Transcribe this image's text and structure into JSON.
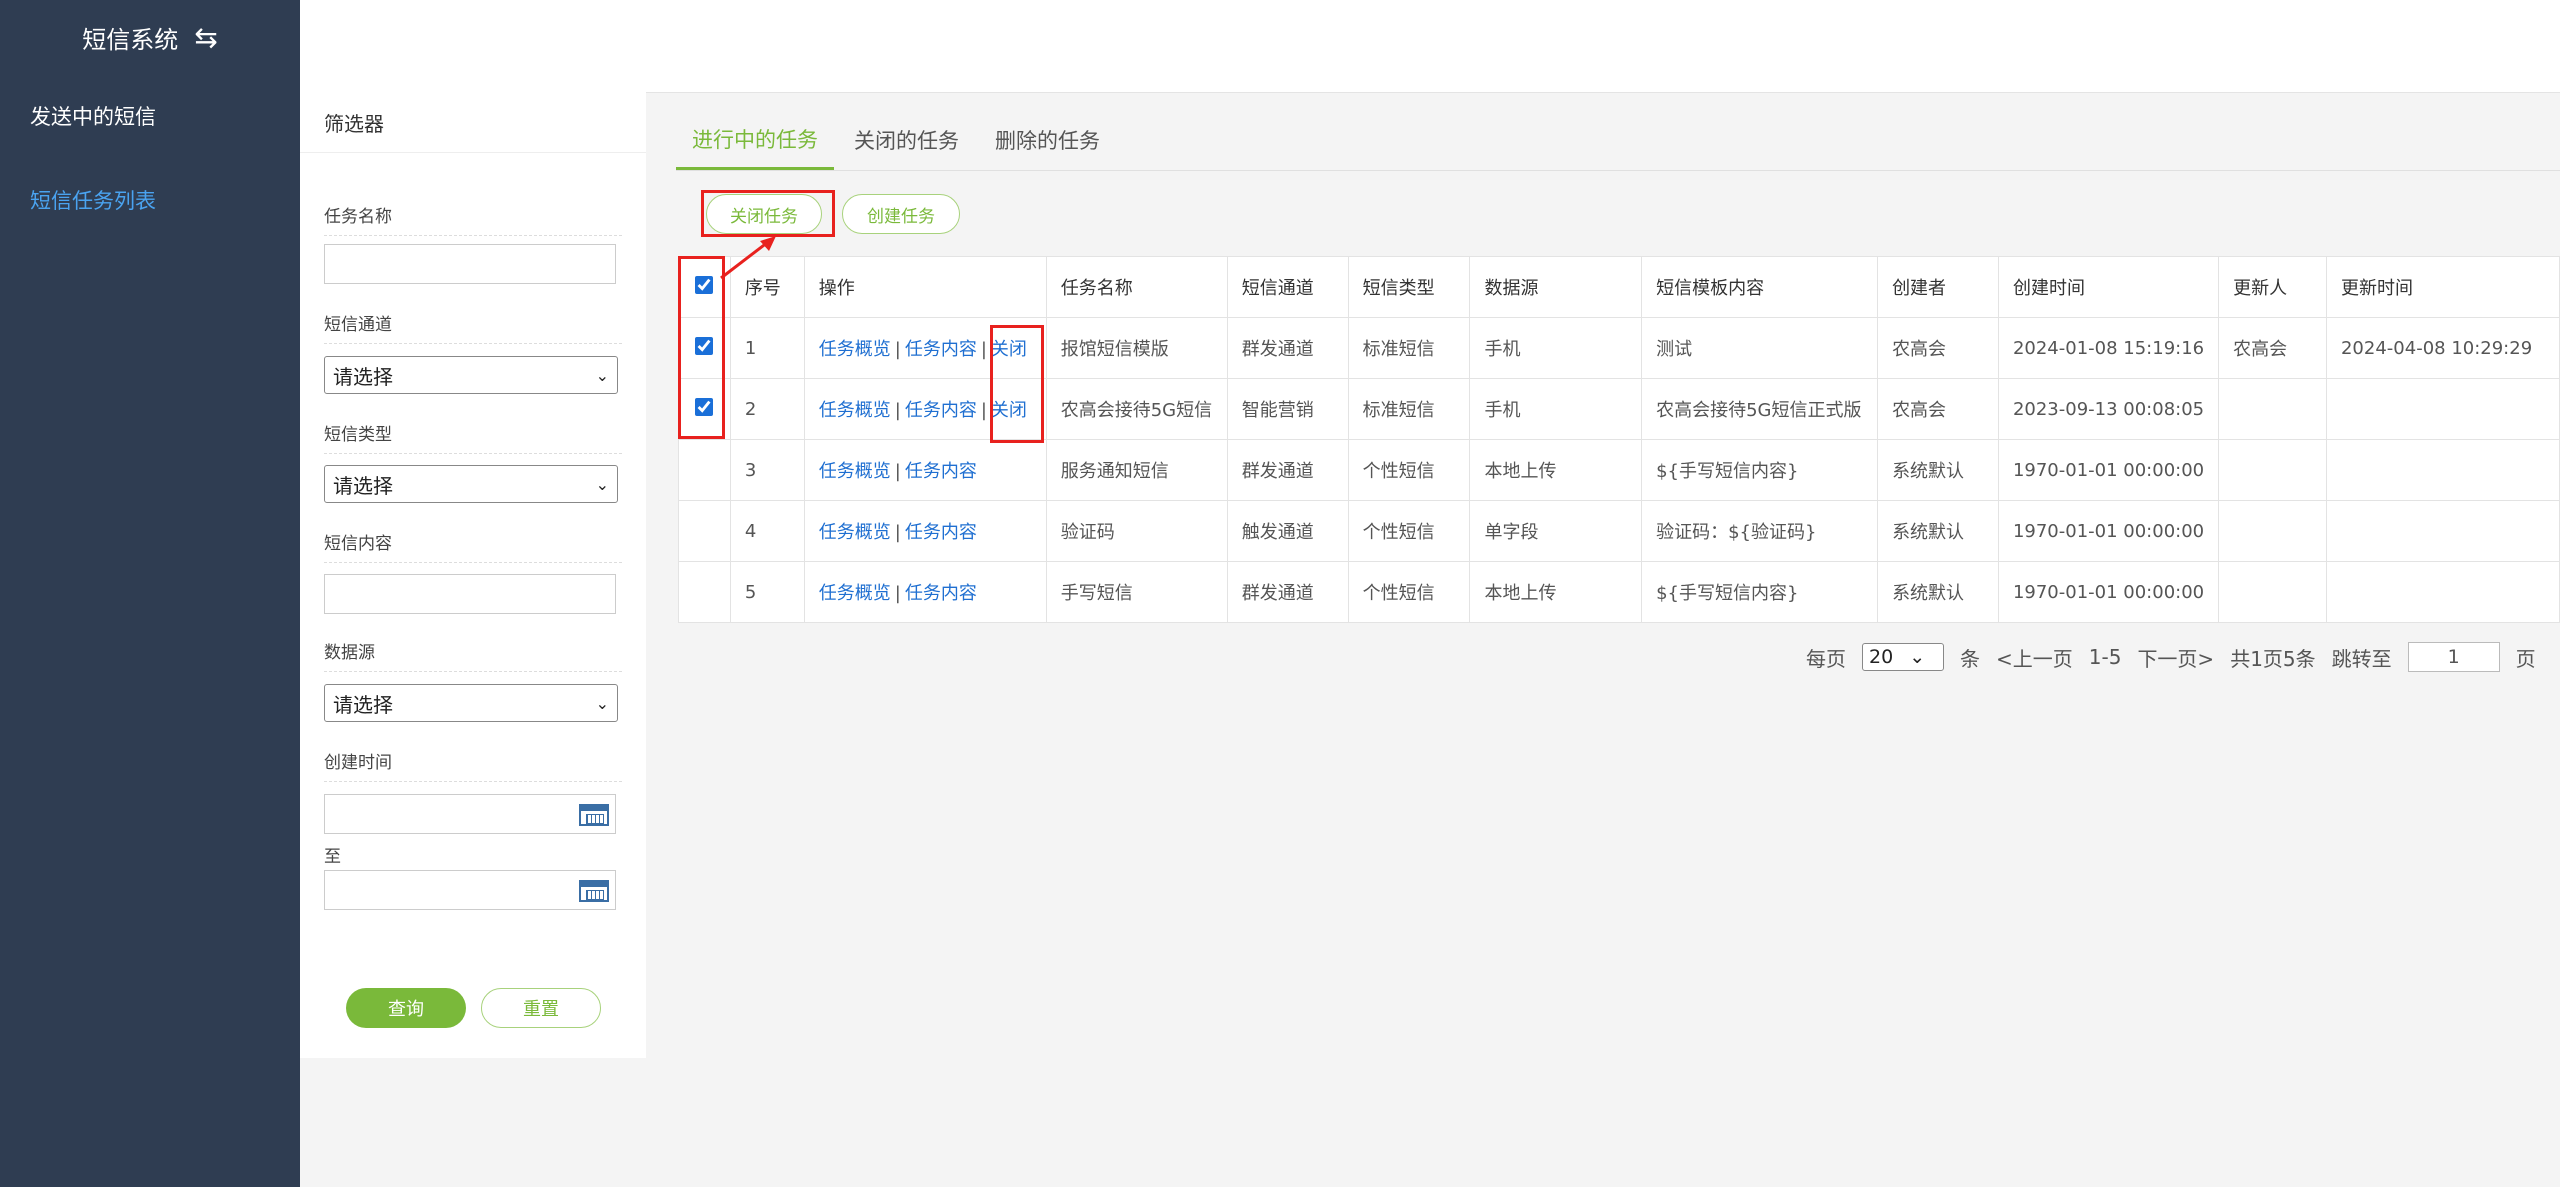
{
  "sidebar": {
    "brand": "短信系统",
    "items": [
      {
        "label": "发送中的短信"
      },
      {
        "label": "短信任务列表"
      }
    ]
  },
  "filter": {
    "title": "筛选器",
    "task_name_label": "任务名称",
    "channel_label": "短信通道",
    "channel_value": "请选择",
    "type_label": "短信类型",
    "type_value": "请选择",
    "content_label": "短信内容",
    "source_label": "数据源",
    "source_value": "请选择",
    "created_label": "创建时间",
    "to_label": "至",
    "query_label": "查询",
    "reset_label": "重置"
  },
  "tabs": [
    {
      "label": "进行中的任务",
      "active": true
    },
    {
      "label": "关闭的任务"
    },
    {
      "label": "删除的任务"
    }
  ],
  "actions": {
    "close_label": "关闭任务",
    "create_label": "创建任务"
  },
  "table": {
    "headers": [
      "序号",
      "操作",
      "任务名称",
      "短信通道",
      "短信类型",
      "数据源",
      "短信模板内容",
      "创建者",
      "创建时间",
      "更新人",
      "更新时间"
    ],
    "op_labels": {
      "overview": "任务概览",
      "content": "任务内容",
      "close": "关闭",
      "sep": "|"
    },
    "rows": [
      {
        "checked": true,
        "seq": "1",
        "name": "报馆短信模版",
        "channel": "群发通道",
        "type": "标准短信",
        "source": "手机",
        "template": "测试",
        "creator": "农高会",
        "created": "2024-01-08 15:19:16",
        "updater": "农高会",
        "updated": "2024-04-08 10:29:29"
      },
      {
        "checked": true,
        "seq": "2",
        "name": "农高会接待5G短信",
        "channel": "智能营销",
        "type": "标准短信",
        "source": "手机",
        "template": "农高会接待5G短信正式版",
        "creator": "农高会",
        "created": "2023-09-13 00:08:05",
        "updater": "",
        "updated": ""
      },
      {
        "checked": false,
        "seq": "3",
        "name": "服务通知短信",
        "channel": "群发通道",
        "type": "个性短信",
        "source": "本地上传",
        "template": "${手写短信内容}",
        "creator": "系统默认",
        "created": "1970-01-01 00:00:00",
        "updater": "",
        "updated": ""
      },
      {
        "checked": false,
        "seq": "4",
        "name": "验证码",
        "channel": "触发通道",
        "type": "个性短信",
        "source": "单字段",
        "template": "验证码：${验证码}",
        "creator": "系统默认",
        "created": "1970-01-01 00:00:00",
        "updater": "",
        "updated": ""
      },
      {
        "checked": false,
        "seq": "5",
        "name": "手写短信",
        "channel": "群发通道",
        "type": "个性短信",
        "source": "本地上传",
        "template": "${手写短信内容}",
        "creator": "系统默认",
        "created": "1970-01-01 00:00:00",
        "updater": "",
        "updated": ""
      }
    ]
  },
  "pager": {
    "per_page_label": "每页",
    "per_page_value": "20",
    "unit": "条",
    "prev": "<上一页",
    "range": "1-5",
    "next": "下一页>",
    "summary": "共1页5条",
    "jump_label": "跳转至",
    "jump_value": "1",
    "page_unit": "页"
  },
  "colors": {
    "sidebar_bg": "#2f3d52",
    "accent_green": "#7ab93a",
    "link_blue": "#1f6fd1",
    "highlight_red": "#e8211e"
  }
}
